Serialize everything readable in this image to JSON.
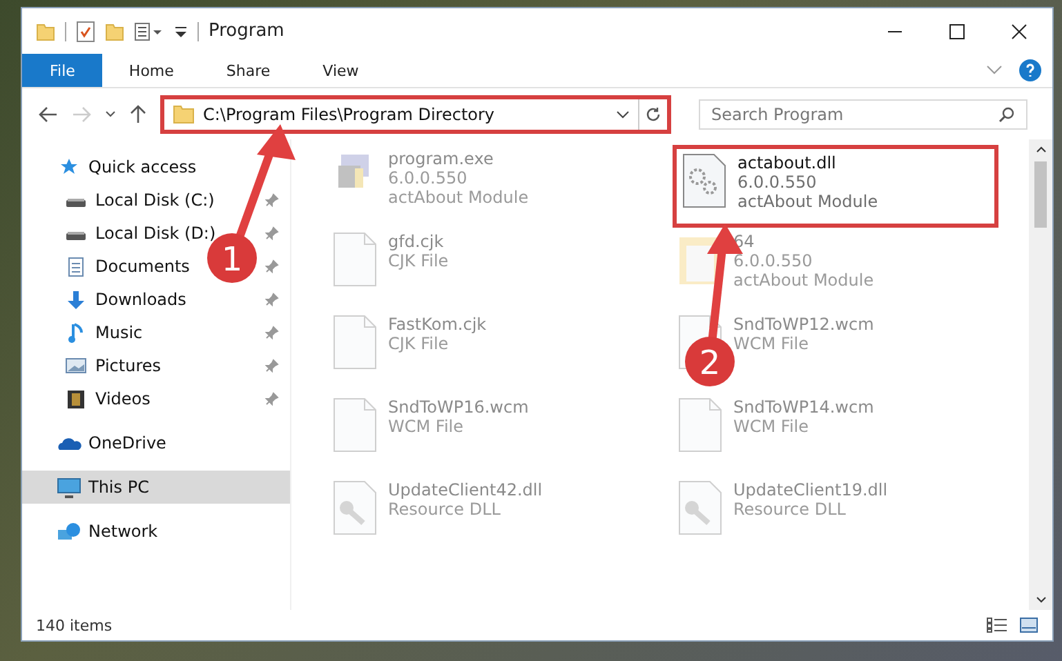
{
  "window": {
    "title": "Program"
  },
  "ribbon_tabs": [
    {
      "label": "File",
      "selected": true
    },
    {
      "label": "Home",
      "selected": false
    },
    {
      "label": "Share",
      "selected": false
    },
    {
      "label": "View",
      "selected": false
    }
  ],
  "address_bar": {
    "value": "C:\\Program Files\\Program Directory",
    "highlighted": true
  },
  "search": {
    "placeholder": "Search Program"
  },
  "sidebar": {
    "items": [
      {
        "label": "Quick access",
        "selected": false,
        "children": [
          {
            "label": "Local Disk (C:)",
            "selected": false,
            "pinned": true
          },
          {
            "label": "Local Disk (D:)",
            "selected": false,
            "pinned": true
          },
          {
            "label": "Documents",
            "selected": false,
            "pinned": true
          },
          {
            "label": "Downloads",
            "selected": false,
            "pinned": true
          },
          {
            "label": "Music",
            "selected": false,
            "pinned": true
          },
          {
            "label": "Pictures",
            "selected": false,
            "pinned": true
          },
          {
            "label": "Videos",
            "selected": false,
            "pinned": true
          }
        ]
      },
      {
        "label": "OneDrive",
        "selected": false
      },
      {
        "label": "This PC",
        "selected": true
      },
      {
        "label": "Network",
        "selected": false
      }
    ]
  },
  "files": [
    {
      "name": "program.exe",
      "lines": [
        "6.0.0.550",
        "actAbout Module"
      ],
      "kind": "application",
      "faded": true,
      "highlighted": false
    },
    {
      "name": "actabout.dll",
      "lines": [
        "6.0.0.550",
        "actAbout Module"
      ],
      "kind": "module",
      "faded": false,
      "highlighted": true
    },
    {
      "name": "gfd.cjk",
      "lines": [
        "CJK File"
      ],
      "kind": "plain",
      "faded": true,
      "highlighted": false
    },
    {
      "name": "64",
      "lines": [
        "6.0.0.550",
        "actAbout Module"
      ],
      "kind": "archive",
      "faded": true,
      "highlighted": false
    },
    {
      "name": "FastKom.cjk",
      "lines": [
        "CJK File"
      ],
      "kind": "plain",
      "faded": true,
      "highlighted": false
    },
    {
      "name": "SndToWP12.wcm",
      "lines": [
        "WCM File"
      ],
      "kind": "plain",
      "faded": true,
      "highlighted": false
    },
    {
      "name": "SndToWP16.wcm",
      "lines": [
        "WCM File"
      ],
      "kind": "plain",
      "faded": true,
      "highlighted": false
    },
    {
      "name": "SndToWP14.wcm",
      "lines": [
        "WCM File"
      ],
      "kind": "plain",
      "faded": true,
      "highlighted": false
    },
    {
      "name": "UpdateClient42.dll",
      "lines": [
        "Resource DLL"
      ],
      "kind": "resource",
      "faded": true,
      "highlighted": false
    },
    {
      "name": "UpdateClient19.dll",
      "lines": [
        "Resource DLL"
      ],
      "kind": "resource",
      "faded": true,
      "highlighted": false
    }
  ],
  "status_bar": {
    "count": "140 items"
  },
  "callouts": [
    {
      "number": "1"
    },
    {
      "number": "2"
    }
  ]
}
